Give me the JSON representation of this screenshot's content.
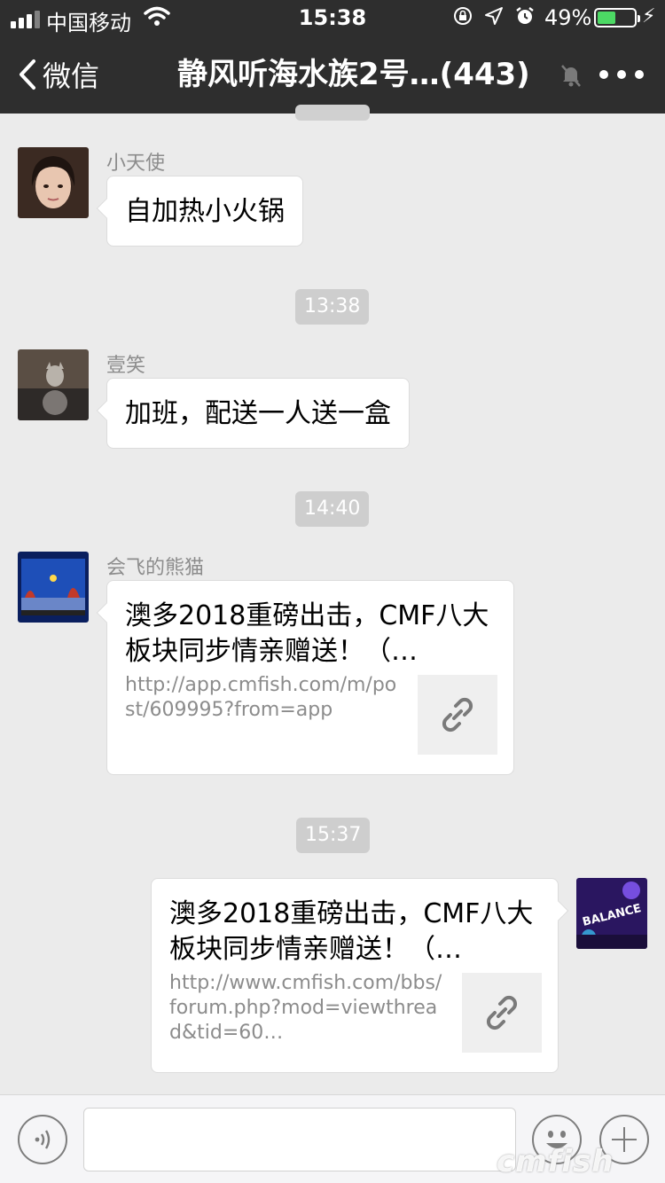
{
  "status_bar": {
    "carrier": "中国移动",
    "time": "15:38",
    "battery_percent": "49%",
    "battery_level": 0.49
  },
  "nav": {
    "back_label": "微信",
    "title": "静风听海水族2号…(443)"
  },
  "messages": [
    {
      "type": "text",
      "side": "left",
      "sender": "小天使",
      "text": "自加热小火锅"
    },
    {
      "type": "time",
      "text": "13:38"
    },
    {
      "type": "text",
      "side": "left",
      "sender": "壹笑",
      "text": "加班，配送一人送一盒"
    },
    {
      "type": "time",
      "text": "14:40"
    },
    {
      "type": "link",
      "side": "left",
      "sender": "会飞的熊猫",
      "title": "澳多2018重磅出击，CMF八大板块同步情亲赠送！（…",
      "url": "http://app.cmfish.com/m/post/609995?from=app"
    },
    {
      "type": "time",
      "text": "15:37"
    },
    {
      "type": "link",
      "side": "right",
      "title": "澳多2018重磅出击，CMF八大板块同步情亲赠送！（…",
      "url": "http://www.cmfish.com/bbs/forum.php?mod=viewthread&tid=60…"
    }
  ],
  "input": {
    "value": ""
  },
  "watermark": "cmfish",
  "avatar_badge": "BALANCE",
  "colors": {
    "nav_bg": "#2e2e2e",
    "chat_bg": "#ebebeb",
    "battery": "#4cd964"
  }
}
